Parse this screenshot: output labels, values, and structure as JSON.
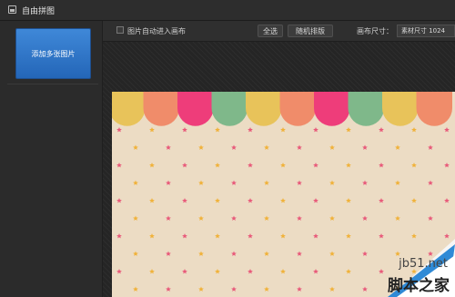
{
  "window": {
    "title": "自由拼图"
  },
  "sidebar": {
    "add_button_label": "添加多张图片"
  },
  "toolbar": {
    "auto_enter_label": "图片自动进入画布",
    "auto_enter_checked": false,
    "select_all_label": "全选",
    "random_sort_label": "随机排版",
    "canvas_size_label": "画布尺寸：",
    "canvas_size_value": "素材尺寸 1024"
  },
  "canvas": {
    "background": "#ecdcc4",
    "scallop_colors": [
      "#e8c35a",
      "#f08c6a",
      "#ee3d7a",
      "#7fb88a",
      "#e8c35a",
      "#f08c6a",
      "#ee3d7a",
      "#7fb88a",
      "#e8c35a",
      "#f08c6a"
    ],
    "star_colors": [
      "#e85a7a",
      "#f0b23a"
    ]
  },
  "watermark": {
    "site": "jb51.net",
    "name": "脚本之家"
  }
}
